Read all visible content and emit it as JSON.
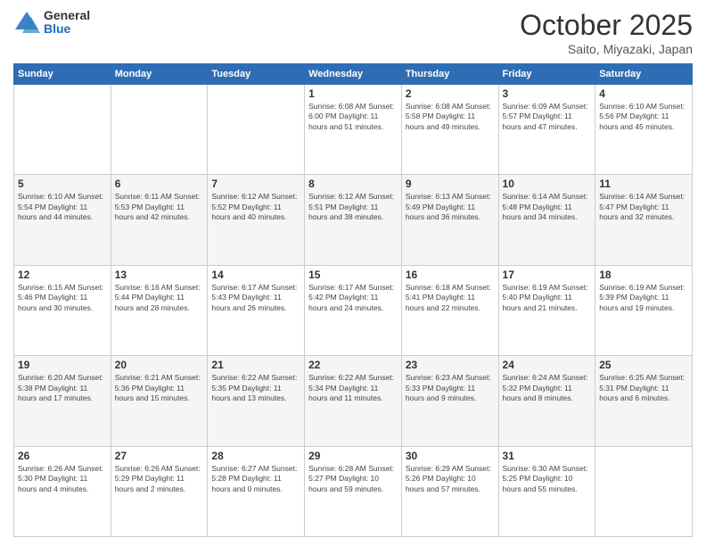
{
  "header": {
    "logo_general": "General",
    "logo_blue": "Blue",
    "month": "October 2025",
    "location": "Saito, Miyazaki, Japan"
  },
  "weekdays": [
    "Sunday",
    "Monday",
    "Tuesday",
    "Wednesday",
    "Thursday",
    "Friday",
    "Saturday"
  ],
  "weeks": [
    [
      {
        "day": "",
        "info": ""
      },
      {
        "day": "",
        "info": ""
      },
      {
        "day": "",
        "info": ""
      },
      {
        "day": "1",
        "info": "Sunrise: 6:08 AM\nSunset: 6:00 PM\nDaylight: 11 hours\nand 51 minutes."
      },
      {
        "day": "2",
        "info": "Sunrise: 6:08 AM\nSunset: 5:58 PM\nDaylight: 11 hours\nand 49 minutes."
      },
      {
        "day": "3",
        "info": "Sunrise: 6:09 AM\nSunset: 5:57 PM\nDaylight: 11 hours\nand 47 minutes."
      },
      {
        "day": "4",
        "info": "Sunrise: 6:10 AM\nSunset: 5:56 PM\nDaylight: 11 hours\nand 45 minutes."
      }
    ],
    [
      {
        "day": "5",
        "info": "Sunrise: 6:10 AM\nSunset: 5:54 PM\nDaylight: 11 hours\nand 44 minutes."
      },
      {
        "day": "6",
        "info": "Sunrise: 6:11 AM\nSunset: 5:53 PM\nDaylight: 11 hours\nand 42 minutes."
      },
      {
        "day": "7",
        "info": "Sunrise: 6:12 AM\nSunset: 5:52 PM\nDaylight: 11 hours\nand 40 minutes."
      },
      {
        "day": "8",
        "info": "Sunrise: 6:12 AM\nSunset: 5:51 PM\nDaylight: 11 hours\nand 38 minutes."
      },
      {
        "day": "9",
        "info": "Sunrise: 6:13 AM\nSunset: 5:49 PM\nDaylight: 11 hours\nand 36 minutes."
      },
      {
        "day": "10",
        "info": "Sunrise: 6:14 AM\nSunset: 5:48 PM\nDaylight: 11 hours\nand 34 minutes."
      },
      {
        "day": "11",
        "info": "Sunrise: 6:14 AM\nSunset: 5:47 PM\nDaylight: 11 hours\nand 32 minutes."
      }
    ],
    [
      {
        "day": "12",
        "info": "Sunrise: 6:15 AM\nSunset: 5:46 PM\nDaylight: 11 hours\nand 30 minutes."
      },
      {
        "day": "13",
        "info": "Sunrise: 6:16 AM\nSunset: 5:44 PM\nDaylight: 11 hours\nand 28 minutes."
      },
      {
        "day": "14",
        "info": "Sunrise: 6:17 AM\nSunset: 5:43 PM\nDaylight: 11 hours\nand 26 minutes."
      },
      {
        "day": "15",
        "info": "Sunrise: 6:17 AM\nSunset: 5:42 PM\nDaylight: 11 hours\nand 24 minutes."
      },
      {
        "day": "16",
        "info": "Sunrise: 6:18 AM\nSunset: 5:41 PM\nDaylight: 11 hours\nand 22 minutes."
      },
      {
        "day": "17",
        "info": "Sunrise: 6:19 AM\nSunset: 5:40 PM\nDaylight: 11 hours\nand 21 minutes."
      },
      {
        "day": "18",
        "info": "Sunrise: 6:19 AM\nSunset: 5:39 PM\nDaylight: 11 hours\nand 19 minutes."
      }
    ],
    [
      {
        "day": "19",
        "info": "Sunrise: 6:20 AM\nSunset: 5:38 PM\nDaylight: 11 hours\nand 17 minutes."
      },
      {
        "day": "20",
        "info": "Sunrise: 6:21 AM\nSunset: 5:36 PM\nDaylight: 11 hours\nand 15 minutes."
      },
      {
        "day": "21",
        "info": "Sunrise: 6:22 AM\nSunset: 5:35 PM\nDaylight: 11 hours\nand 13 minutes."
      },
      {
        "day": "22",
        "info": "Sunrise: 6:22 AM\nSunset: 5:34 PM\nDaylight: 11 hours\nand 11 minutes."
      },
      {
        "day": "23",
        "info": "Sunrise: 6:23 AM\nSunset: 5:33 PM\nDaylight: 11 hours\nand 9 minutes."
      },
      {
        "day": "24",
        "info": "Sunrise: 6:24 AM\nSunset: 5:32 PM\nDaylight: 11 hours\nand 8 minutes."
      },
      {
        "day": "25",
        "info": "Sunrise: 6:25 AM\nSunset: 5:31 PM\nDaylight: 11 hours\nand 6 minutes."
      }
    ],
    [
      {
        "day": "26",
        "info": "Sunrise: 6:26 AM\nSunset: 5:30 PM\nDaylight: 11 hours\nand 4 minutes."
      },
      {
        "day": "27",
        "info": "Sunrise: 6:26 AM\nSunset: 5:29 PM\nDaylight: 11 hours\nand 2 minutes."
      },
      {
        "day": "28",
        "info": "Sunrise: 6:27 AM\nSunset: 5:28 PM\nDaylight: 11 hours\nand 0 minutes."
      },
      {
        "day": "29",
        "info": "Sunrise: 6:28 AM\nSunset: 5:27 PM\nDaylight: 10 hours\nand 59 minutes."
      },
      {
        "day": "30",
        "info": "Sunrise: 6:29 AM\nSunset: 5:26 PM\nDaylight: 10 hours\nand 57 minutes."
      },
      {
        "day": "31",
        "info": "Sunrise: 6:30 AM\nSunset: 5:25 PM\nDaylight: 10 hours\nand 55 minutes."
      },
      {
        "day": "",
        "info": ""
      }
    ]
  ]
}
